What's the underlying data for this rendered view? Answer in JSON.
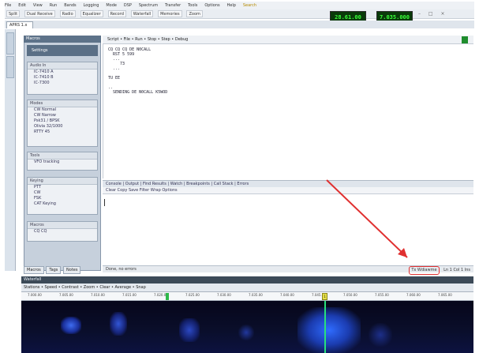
{
  "menubar": {
    "items": [
      "File",
      "Edit",
      "View",
      "Run",
      "Bands",
      "Logging",
      "Mode",
      "DSP",
      "Spectrum",
      "Transfer",
      "Tools",
      "Options",
      "Help",
      "Search"
    ]
  },
  "toolbar": {
    "buttons": [
      "Split",
      "Dual Receive",
      "Radio",
      "Equalizer",
      "Record",
      "Waterfall",
      "Memories",
      "Zoom"
    ]
  },
  "freq": {
    "display_a": "28.61.00",
    "display_b": "7.035.000"
  },
  "tab": {
    "main": "APRS 1.x"
  },
  "left": {
    "header": "Macros",
    "sub": "Settings",
    "groups": [
      {
        "title": "Audio In",
        "items": [
          "IC-7410 A",
          "IC-7410 B",
          "IC-7300"
        ]
      },
      {
        "title": "Modes",
        "items": [
          "CW Normal",
          "CW Narrow",
          "Psk31 / BPSK",
          "Olivia 32/1000",
          "RTTY 45"
        ]
      },
      {
        "title": "Tools",
        "items": [
          "VFO tracking"
        ]
      },
      {
        "title": "Keying",
        "items": [
          "PTT",
          "CW",
          "FSK",
          "CAT Keying"
        ]
      },
      {
        "title": "Macros",
        "items": [
          "CQ CQ"
        ]
      }
    ],
    "bottom_tabs": [
      "Macros",
      "Tags",
      "Notes"
    ]
  },
  "editor": {
    "toolbar_text": "Script • File • Run • Stop • Step • Debug",
    "code": "CQ CQ CQ DE N0CALL\n  RST 5 599\n  ...\n     73\n  ...\n\nTU EE\n\n..\n  SENDING DE N0CALL K5WOD\n"
  },
  "console": {
    "bar1": "Console  |  Output  |  Find Results  |  Watch  |  Breakpoints  |  Call Stack  |  Errors",
    "bar2": "Clear  Copy  Save  Filter  Wrap  Options"
  },
  "status": {
    "left": "Done, no errors",
    "highlight": "Tx Wdiawme",
    "right": "Ln 1  Col 1  Ins"
  },
  "waterfall": {
    "title": "Waterfall",
    "controls": "Stations • Speed • Contrast • Zoom • Clear • Average • Snap",
    "ticks": [
      "7.000.00",
      "7.005.00",
      "7.010.00",
      "7.015.00",
      "7.020.00",
      "7.025.00",
      "7.030.00",
      "7.035.00",
      "7.040.00",
      "7.045.00",
      "7.050.00",
      "7.055.00",
      "7.060.00",
      "7.065.00"
    ],
    "marker_label": "1"
  },
  "colors": {
    "accent_red": "#e03030",
    "freq_green": "#3aff3a",
    "waterfall_signal": "#27e07b"
  }
}
